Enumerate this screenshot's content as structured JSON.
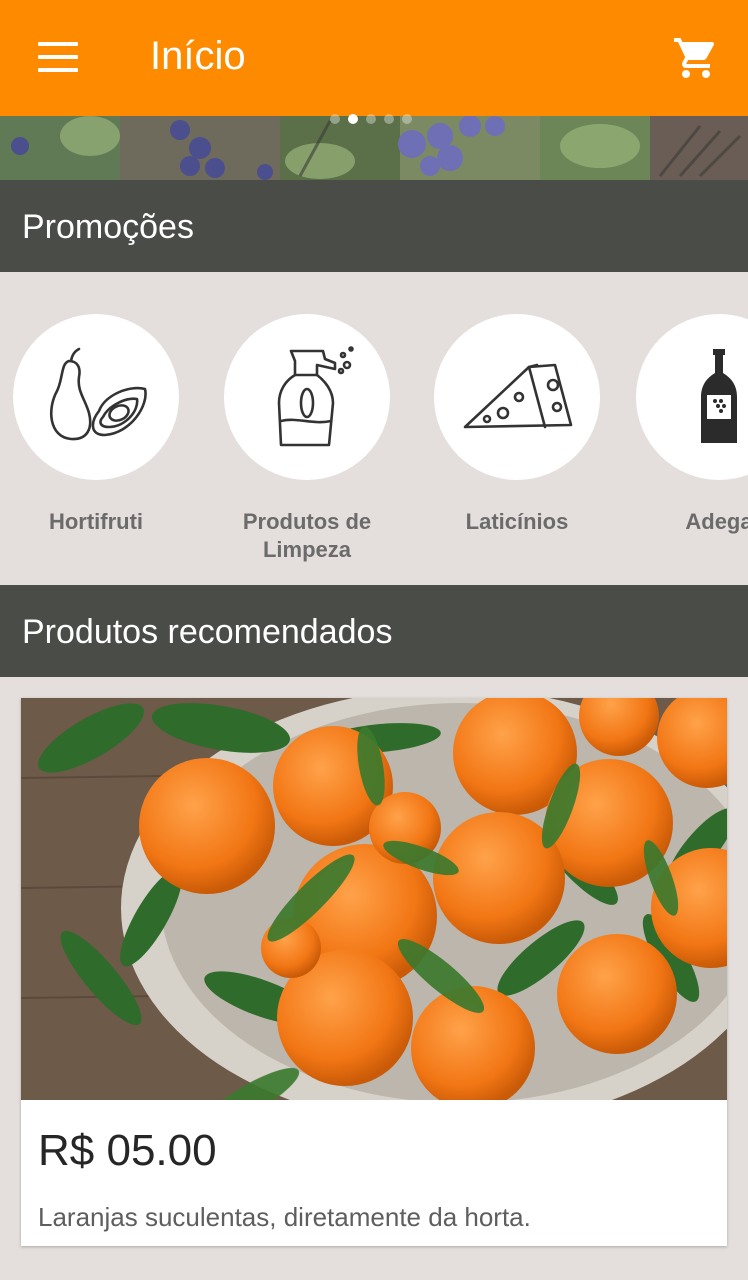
{
  "appbar": {
    "title": "Início",
    "menu_icon": "menu-icon",
    "cart_icon": "shopping-cart-icon",
    "color": "#fe8a00"
  },
  "banner": {
    "slide_count": 5,
    "active_slide": 2
  },
  "sections": {
    "promotions": "Promoções",
    "recommended": "Produtos recomendados"
  },
  "categories": [
    {
      "label": "Hortifruti",
      "icon": "pear-avocado-icon"
    },
    {
      "label": "Produtos de\nLimpeza",
      "icon": "spray-bottle-icon"
    },
    {
      "label": "Laticínios",
      "icon": "cheese-icon"
    },
    {
      "label": "Adega",
      "icon": "wine-bottle-icon"
    }
  ],
  "products": [
    {
      "price": "R$ 05.00",
      "description": "Laranjas suculentas, diretamente da horta.",
      "image": "oranges-basket-photo"
    }
  ]
}
